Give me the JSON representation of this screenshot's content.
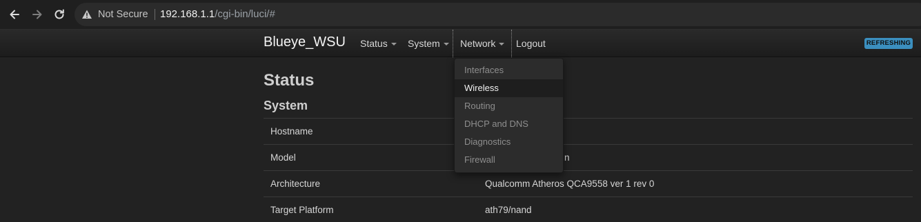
{
  "browser": {
    "security_label": "Not Secure",
    "url_host": "192.168.1.1",
    "url_path": "/cgi-bin/luci/#"
  },
  "navbar": {
    "brand": "Blueye_WSU",
    "menu": [
      {
        "label": "Status",
        "has_caret": true
      },
      {
        "label": "System",
        "has_caret": true
      },
      {
        "label": "Network",
        "has_caret": true,
        "active": true
      },
      {
        "label": "Logout",
        "has_caret": false
      }
    ],
    "badge": "REFRESHING"
  },
  "dropdown": {
    "items": [
      {
        "label": "Interfaces"
      },
      {
        "label": "Wireless",
        "selected": true
      },
      {
        "label": "Routing"
      },
      {
        "label": "DHCP and DNS"
      },
      {
        "label": "Diagnostics"
      },
      {
        "label": "Firewall"
      }
    ]
  },
  "main": {
    "page_title": "Status",
    "section_title": "System",
    "rows": [
      {
        "key": "Hostname",
        "value": ""
      },
      {
        "key": "Model",
        "value": "n"
      },
      {
        "key": "Architecture",
        "value": "Qualcomm Atheros QCA9558 ver 1 rev 0"
      },
      {
        "key": "Target Platform",
        "value": "ath79/nand"
      }
    ]
  },
  "colors": {
    "badge": "#3b8fbf",
    "background": "#222222"
  }
}
